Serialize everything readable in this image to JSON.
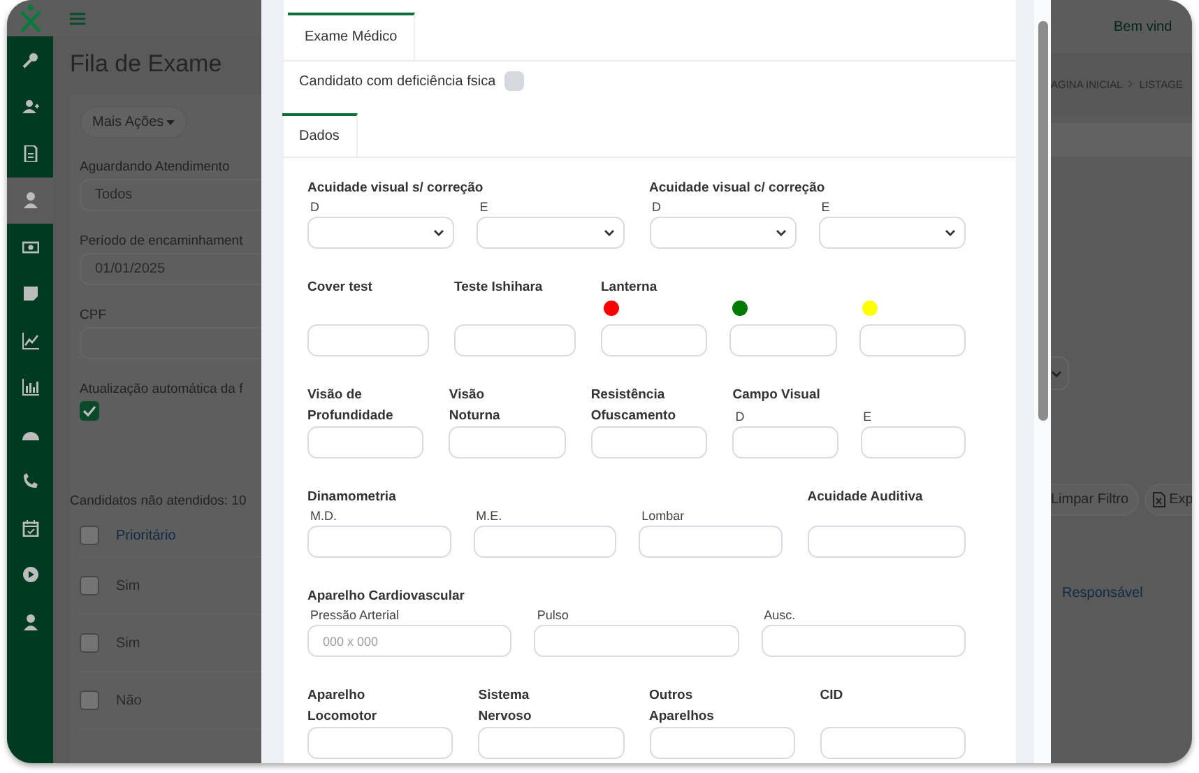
{
  "header": {
    "welcome": "Bem vind"
  },
  "sidebar": {
    "items": [
      {
        "selected": false
      },
      {
        "selected": false
      },
      {
        "selected": false
      },
      {
        "selected": true
      },
      {
        "selected": false
      },
      {
        "selected": false
      },
      {
        "selected": false
      },
      {
        "selected": false
      },
      {
        "selected": false
      },
      {
        "selected": false
      },
      {
        "selected": false
      },
      {
        "selected": false
      },
      {
        "selected": false
      }
    ]
  },
  "page": {
    "title": "Fila de Exame",
    "more_actions": "Mais Ações",
    "waiting_label": "Aguardando Atendimento",
    "waiting_value": "Todos",
    "period_label": "Período de encaminhament",
    "period_value": "01/01/2025",
    "cpf_label": "CPF",
    "auto_update": {
      "label": "Atualização automática da f",
      "checked": true
    },
    "count_text": "Candidatos não atendidos: 10",
    "table": {
      "all_checked": false,
      "columns": [
        "Prioritário"
      ],
      "rows": [
        {
          "cells": [
            "Sim"
          ],
          "checked": false
        },
        {
          "cells": [
            "Sim"
          ],
          "checked": false
        },
        {
          "cells": [
            "Não"
          ],
          "checked": false
        }
      ]
    }
  },
  "right": {
    "breadcrumb": [
      "AGINA INICIAL",
      "LISTAGE"
    ],
    "clear_button": "Limpar Filtro",
    "export_button": "Exp",
    "column_heading": "Responsável"
  },
  "modal": {
    "tab": {
      "label": "Exame Médico",
      "selected": true
    },
    "disability": {
      "label": "Candidato com deficiência fsica",
      "checked": false
    },
    "sub_tab": {
      "label": "Dados",
      "selected": true
    },
    "form_rows": [
      {
        "groups": [
          {
            "title": "Acuidade visual s/ correção",
            "fields": [
              {
                "label": "D",
                "kind": "select"
              },
              {
                "label": "E",
                "kind": "select"
              }
            ]
          },
          {
            "title": "Acuidade visual c/ correção",
            "fields": [
              {
                "label": "D",
                "kind": "select"
              },
              {
                "label": "E",
                "kind": "select"
              }
            ]
          }
        ]
      },
      {
        "groups": [
          {
            "title": "Cover test",
            "fields": [
              {
                "kind": "input"
              }
            ]
          },
          {
            "title": "Teste Ishihara",
            "fields": [
              {
                "kind": "input"
              }
            ]
          },
          {
            "title": "Lanterna",
            "fields": [
              {
                "kind": "input",
                "color": "#ff0000"
              },
              {
                "kind": "input",
                "color": "#007a00"
              },
              {
                "kind": "input",
                "color": "#ffff00"
              }
            ]
          }
        ]
      },
      {
        "groups": [
          {
            "title": "Visão de\nProfundidade",
            "fields": [
              {
                "kind": "input"
              }
            ]
          },
          {
            "title": "Visão\nNoturna",
            "fields": [
              {
                "kind": "input"
              }
            ]
          },
          {
            "title": "Resistência\nOfuscamento",
            "fields": [
              {
                "kind": "input"
              }
            ]
          },
          {
            "title": "Campo Visual",
            "fields": [
              {
                "label": "D",
                "kind": "input"
              },
              {
                "label": "E",
                "kind": "input"
              }
            ]
          }
        ]
      },
      {
        "groups": [
          {
            "title": "Dinamometria",
            "fields": [
              {
                "label": "M.D.",
                "kind": "input"
              },
              {
                "label": "M.E.",
                "kind": "input"
              },
              {
                "label": "Lombar",
                "kind": "input"
              }
            ]
          },
          {
            "title": "Acuidade Auditiva",
            "fields": [
              {
                "kind": "input"
              }
            ]
          }
        ]
      },
      {
        "groups": [
          {
            "title": "Aparelho Cardiovascular",
            "fields": [
              {
                "label": "Pressão Arterial",
                "kind": "input",
                "placeholder": "000 x 000"
              },
              {
                "label": "Pulso",
                "kind": "input"
              },
              {
                "label": "Ausc.",
                "kind": "input"
              }
            ]
          }
        ]
      },
      {
        "groups": [
          {
            "title": "Aparelho\nLocomotor",
            "fields": [
              {
                "kind": "input"
              }
            ]
          },
          {
            "title": "Sistema\nNervoso",
            "fields": [
              {
                "kind": "input"
              }
            ]
          },
          {
            "title": "Outros\nAparelhos",
            "fields": [
              {
                "kind": "input"
              }
            ]
          },
          {
            "title": "CID",
            "fields": [
              {
                "kind": "input"
              }
            ]
          }
        ]
      }
    ]
  }
}
